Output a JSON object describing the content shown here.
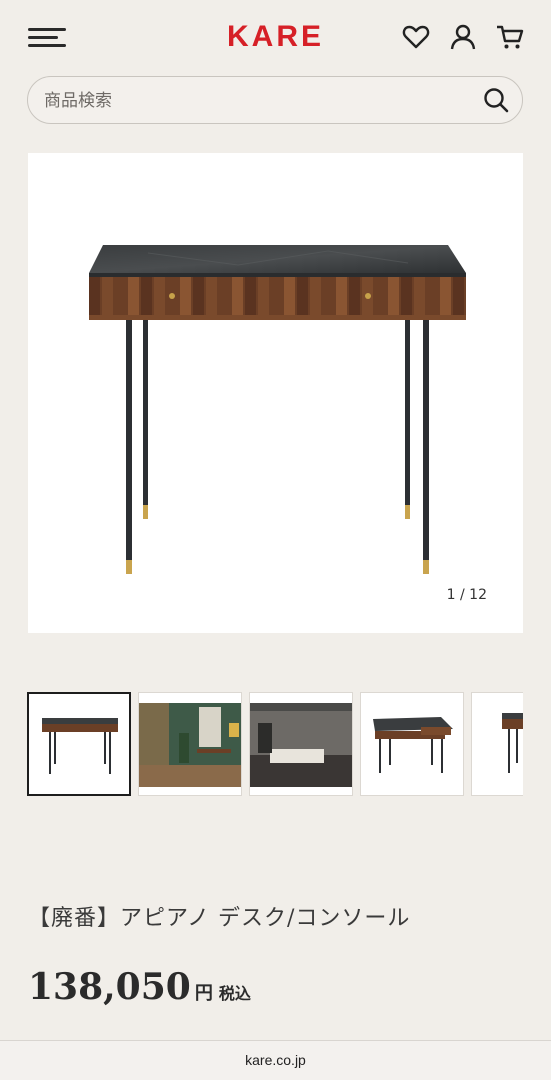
{
  "header": {
    "logo": "KARE",
    "menu_icon": "hamburger-menu-icon",
    "wishlist_icon": "heart-icon",
    "account_icon": "user-icon",
    "cart_icon": "cart-icon",
    "brand_color": "#d62027"
  },
  "search": {
    "placeholder": "商品検索",
    "icon": "search-icon"
  },
  "gallery": {
    "counter": "1 / 12",
    "thumbnails": [
      {
        "label": "desk-front",
        "active": true
      },
      {
        "label": "room-scene-green",
        "active": false
      },
      {
        "label": "bedroom-scene",
        "active": false
      },
      {
        "label": "desk-drawers-open",
        "active": false
      },
      {
        "label": "desk-side",
        "active": false
      }
    ]
  },
  "product": {
    "title": "【廃番】アピアノ デスク/コンソール",
    "price": "138,050",
    "currency": "円",
    "tax_label": "税込"
  },
  "browser": {
    "url": "kare.co.jp"
  }
}
